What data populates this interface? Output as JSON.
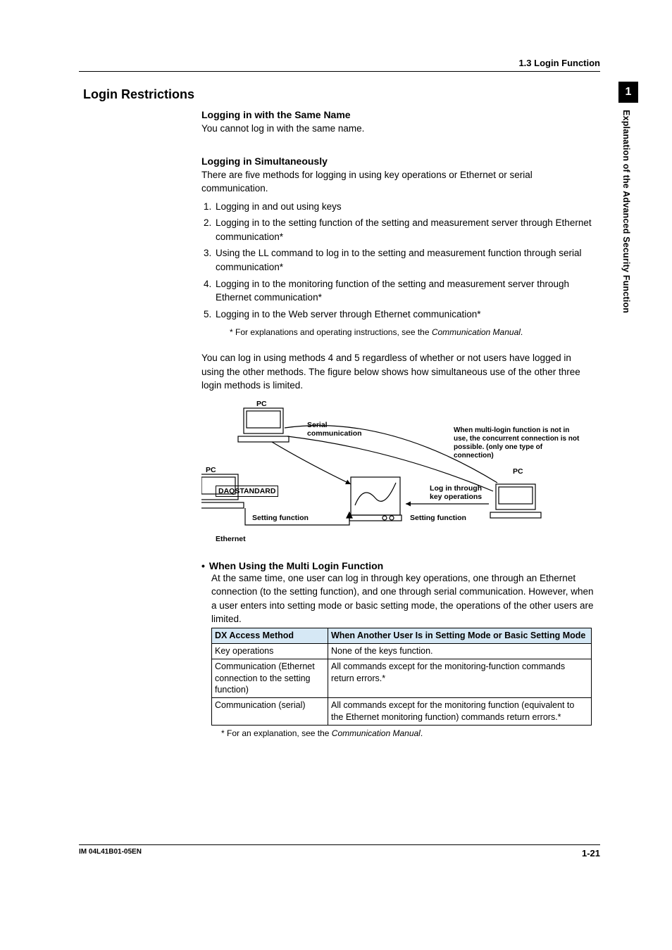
{
  "header": {
    "breadcrumb": "1.3  Login Function"
  },
  "side_tab": {
    "number": "1",
    "label": "Explanation of the Advanced Security Function"
  },
  "title": "Login Restrictions",
  "s1": {
    "head": "Logging in with the Same Name",
    "body": "You cannot log in with the same name."
  },
  "s2": {
    "head": "Logging in Simultaneously",
    "intro": "There are five methods for logging in using key operations or Ethernet or serial communication.",
    "items": [
      "Logging in and out using keys",
      "Logging in to the setting function of the setting and measurement server through Ethernet communication*",
      "Using the LL command to log in to the setting and measurement function through serial communication*",
      "Logging in to the monitoring function of the setting and measurement server through Ethernet communication*",
      "Logging in to the Web server through Ethernet communication*"
    ],
    "note_prefix": "*   For explanations and operating instructions, see the ",
    "note_ital": "Communication Manual",
    "note_suffix": ".",
    "after": "You can log in using methods 4 and 5 regardless of whether or not users have logged in using the other methods. The figure below shows how simultaneous use of the other three login methods is limited."
  },
  "diagram": {
    "pc_top": "PC",
    "pc_left": "PC",
    "pc_right": "PC",
    "serial": "Serial\ncommunication",
    "daq": "DAQSTANDARD",
    "ethernet": "Ethernet",
    "setting_left": "Setting function",
    "setting_right": "Setting function",
    "keyops": "Log in through\nkey operations",
    "warn": "When multi-login function is not in use, the concurrent connection is not possible. (only one type of connection)"
  },
  "s3": {
    "head": "When Using the Multi Login Function",
    "body": "At the same time, one user can log in through key operations, one through an Ethernet connection (to the setting function), and one through serial communication. However, when a user enters into setting mode or basic setting mode, the operations of the other users are limited."
  },
  "table": {
    "h1": "DX Access Method",
    "h2": "When Another User Is in Setting Mode or Basic Setting Mode",
    "rows": [
      {
        "a": "Key operations",
        "b": "None of the keys function."
      },
      {
        "a": "Communication (Ethernet connection to the setting function)",
        "b": "All commands except for the monitoring-function commands return errors.*"
      },
      {
        "a": "Communication (serial)",
        "b": "All commands except for the monitoring function (equivalent to the Ethernet monitoring function) commands return errors.*"
      }
    ],
    "foot_prefix": "*    For an explanation, see the ",
    "foot_ital": "Communication Manual",
    "foot_suffix": "."
  },
  "footer": {
    "left": "IM 04L41B01-05EN",
    "right": "1-21"
  }
}
